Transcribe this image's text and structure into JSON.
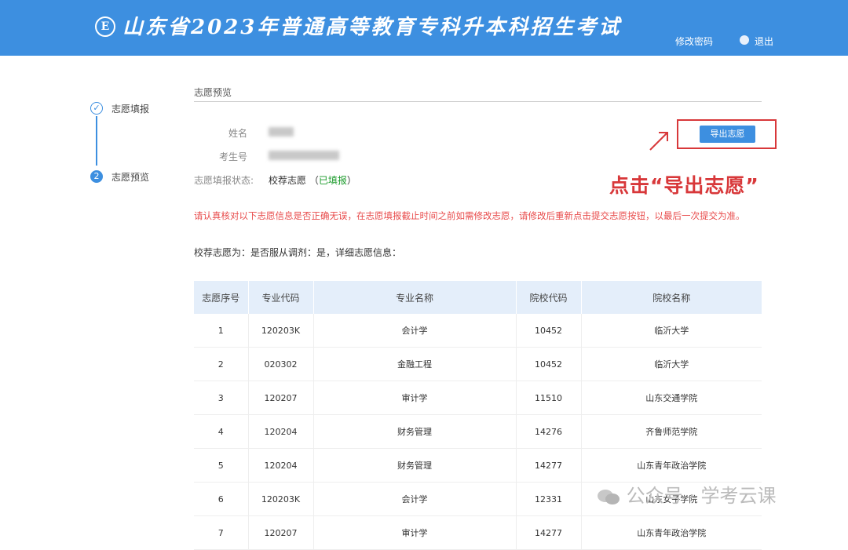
{
  "header": {
    "logo_letter": "E",
    "title": "山东省2023年普通高等教育专科升本科招生考试",
    "change_password": "修改密码",
    "logout": "退出",
    "user_icon": "user-icon"
  },
  "steps": [
    {
      "number": "✓",
      "label": "志愿填报"
    },
    {
      "number": "2",
      "label": "志愿预览"
    }
  ],
  "section": {
    "title": "志愿预览"
  },
  "info": {
    "name_label": "姓名",
    "exam_no_label": "考生号",
    "status_label": "志愿填报状态:",
    "status_value": "校荐志愿",
    "status_open": "（",
    "status_tag": "已填报",
    "status_close": "）"
  },
  "export": {
    "label": "导出志愿"
  },
  "annotation": {
    "text": "点击“导出志愿”",
    "arrow_icon": "arrow-icon"
  },
  "warning": "请认真核对以下志愿信息是否正确无误，在志愿填报截止时间之前如需修改志愿，请修改后重新点击提交志愿按钮，以最后一次提交为准。",
  "detail": "校荐志愿为：是否服从调剂：是，详细志愿信息：",
  "table": {
    "headers": [
      "志愿序号",
      "专业代码",
      "专业名称",
      "院校代码",
      "院校名称"
    ],
    "rows": [
      [
        "1",
        "120203K",
        "会计学",
        "10452",
        "临沂大学"
      ],
      [
        "2",
        "020302",
        "金融工程",
        "10452",
        "临沂大学"
      ],
      [
        "3",
        "120207",
        "审计学",
        "11510",
        "山东交通学院"
      ],
      [
        "4",
        "120204",
        "财务管理",
        "14276",
        "齐鲁师范学院"
      ],
      [
        "5",
        "120204",
        "财务管理",
        "14277",
        "山东青年政治学院"
      ],
      [
        "6",
        "120203K",
        "会计学",
        "12331",
        "山东女子学院"
      ],
      [
        "7",
        "120207",
        "审计学",
        "14277",
        "山东青年政治学院"
      ]
    ]
  },
  "watermark": "公众号 · 学考云课",
  "colors": {
    "primary": "#3d8fe0",
    "annotation": "#d8383a",
    "warning": "#e84b4b",
    "success": "#1a9a2a"
  }
}
